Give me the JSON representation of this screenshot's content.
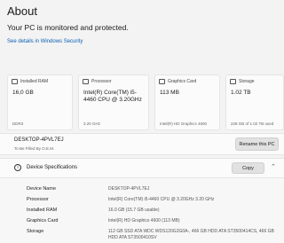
{
  "page": {
    "title": "About",
    "protection": "Your PC is monitored and protected.",
    "security_link": "See details in Windows Security"
  },
  "cards": [
    {
      "label": "Installed RAM",
      "value": "16,0 GB",
      "sub": "DDR3"
    },
    {
      "label": "Processor",
      "value": "Intel(R) Core(TM) i5-4460  CPU @ 3.20GHz",
      "sub": "3.20 GHz"
    },
    {
      "label": "Graphics Card",
      "value": "113 MB",
      "sub": "Intel(R) HD Graphics 4600"
    },
    {
      "label": "Storage",
      "value": "1.02 TB",
      "sub": "228 GB of 1.02 TB used"
    }
  ],
  "device": {
    "name": "DESKTOP-4PVL7EJ",
    "owner": "To Be Filled By O.E.M.",
    "rename_label": "Rename this PC"
  },
  "specs": {
    "title": "Device Specifications",
    "copy_label": "Copy",
    "rows": [
      {
        "key": "Device Name",
        "value": "DESKTOP-4PVL7EJ"
      },
      {
        "key": "Processor",
        "value": "Intel(R) Core(TM) i5-4460  CPU @ 3.20GHz   3.20 GHz"
      },
      {
        "key": "Installed RAM",
        "value": "16.0 GB (15.7 GB usable)"
      },
      {
        "key": "Graphics Card",
        "value": "Intel(R) HD Graphics 4600 (113 MB)"
      },
      {
        "key": "Storage",
        "value": "112 GB SSD ATA WDC WDS120G2G0A-, 466 GB HDD ATA ST3500414CS, 466 GB HDD ATA ST3500410SV"
      }
    ]
  }
}
